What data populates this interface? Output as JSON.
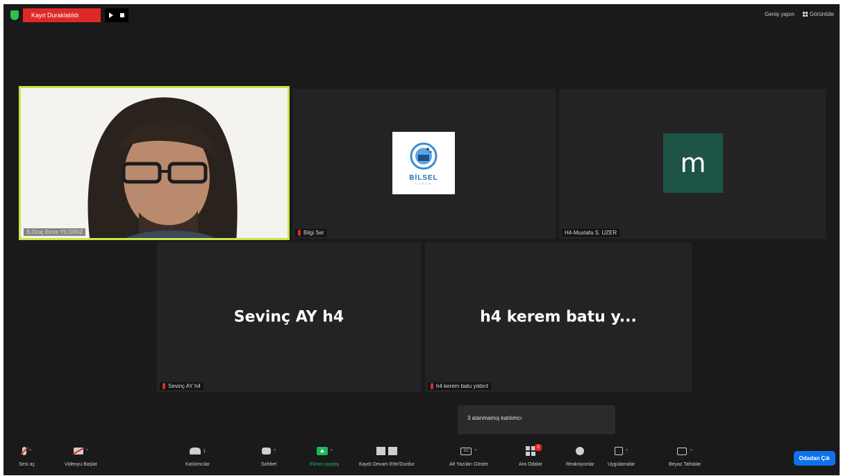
{
  "topbar": {
    "recording_label": "Kayıt Duraklatıldı",
    "exit_fullscreen_label": "Geniş yapın",
    "view_label": "Görüntüle"
  },
  "participants": [
    {
      "id": "video",
      "label": "S.Oruç Emre YILDIRIZ",
      "muted": false
    },
    {
      "id": "bilgi",
      "label": "Bilgi Sel",
      "muted": true
    },
    {
      "id": "mustafa",
      "label": "H4-Mustafa S. UZER",
      "avatar_letter": "m",
      "muted": false
    },
    {
      "id": "sevinc",
      "label": "Sevinç AY h4",
      "display_name": "Sevinç AY h4",
      "muted": true
    },
    {
      "id": "kerem",
      "label": "h4 kerem batu yıldırıt",
      "display_name": "h4 kerem batu y...",
      "muted": true
    }
  ],
  "bilsel_logo": {
    "text": "BİLSEL",
    "sub": "ÇORUM"
  },
  "popup": {
    "text": "3 atanmamış katılımcı"
  },
  "toolbar": {
    "audio": "Sesi aç",
    "video": "Videoyu Başlat",
    "participants": "Katılımcılar",
    "participants_count": "1",
    "chat": "Sohbet",
    "share": "Ekranı paylaş",
    "record": "Kaydı Devam Ettir/Durdur",
    "captions": "Alt Yazıları Göster",
    "rooms": "Ara Odalar",
    "rooms_badge": "3",
    "reactions": "Reaksiyonlar",
    "apps": "Uygulamalar",
    "whiteboard": "Beyaz Tahtalar",
    "leave": "Odadan Çık",
    "caret": "^"
  },
  "colors": {
    "accent_green": "#1db954",
    "record_red": "#e02828",
    "leave_blue": "#0e72ed",
    "active_speaker": "#c6e64a"
  }
}
